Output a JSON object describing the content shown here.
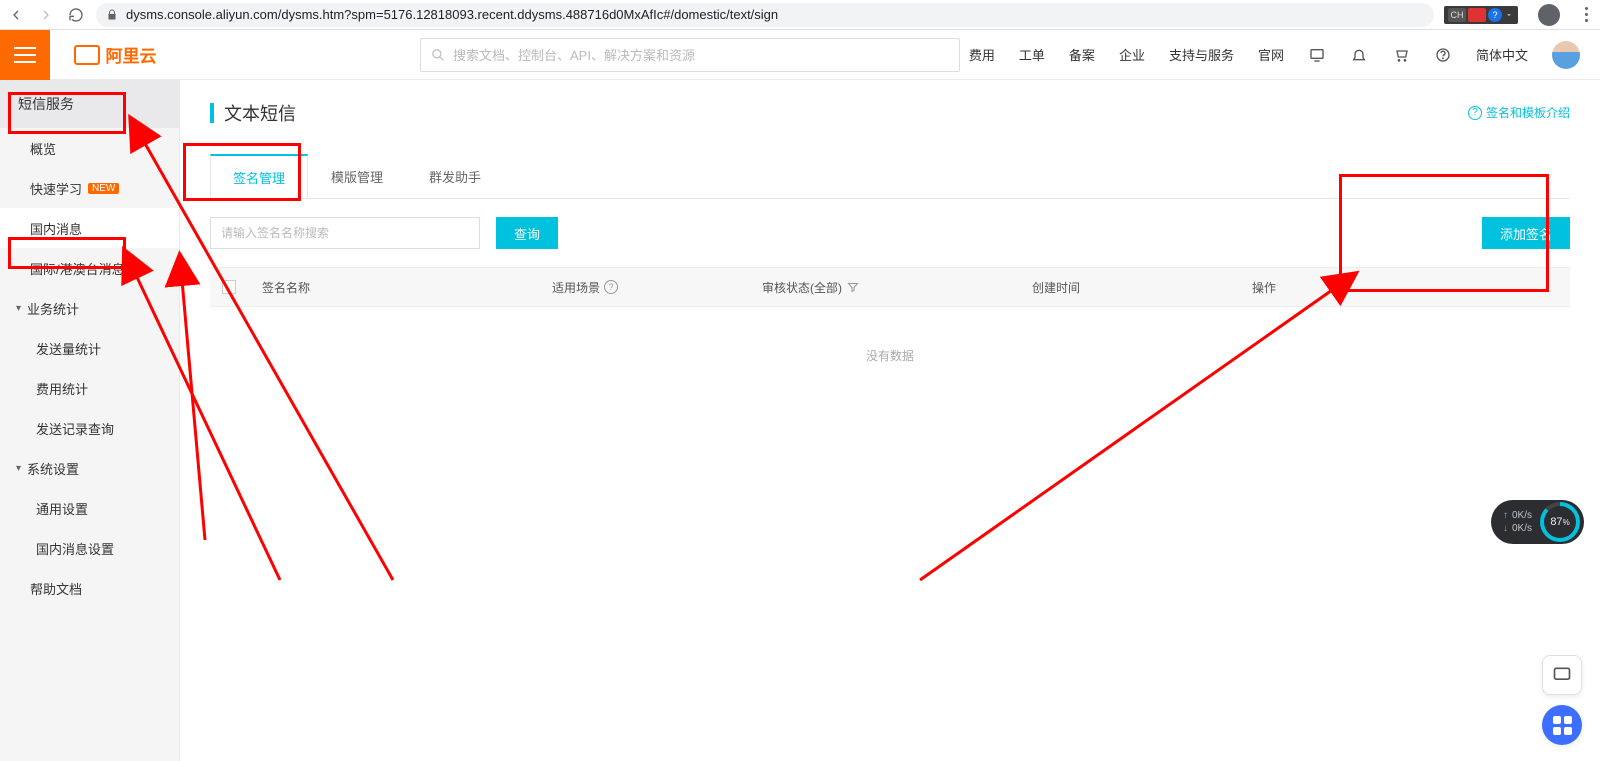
{
  "browser": {
    "url": "dysms.console.aliyun.com/dysms.htm?spm=5176.12818093.recent.ddysms.488716d0MxAfIc#/domestic/text/sign",
    "ext_badge": "CH"
  },
  "logo_text": "阿里云",
  "search_placeholder": "搜索文档、控制台、API、解决方案和资源",
  "top_nav": {
    "fee": "费用",
    "workorder": "工单",
    "beian": "备案",
    "enterprise": "企业",
    "support": "支持与服务",
    "official": "官网",
    "lang": "简体中文"
  },
  "sidebar": {
    "service_title": "短信服务",
    "overview": "概览",
    "quickstart": "快速学习",
    "quickstart_tag": "NEW",
    "domestic": "国内消息",
    "intl": "国际/港澳台消息",
    "stats_group": "业务统计",
    "send_stats": "发送量统计",
    "fee_stats": "费用统计",
    "send_log": "发送记录查询",
    "settings_group": "系统设置",
    "general_settings": "通用设置",
    "domestic_settings": "国内消息设置",
    "help_doc": "帮助文档"
  },
  "page": {
    "title": "文本短信",
    "help_link": "签名和模板介绍"
  },
  "tabs": {
    "sign": "签名管理",
    "template": "模版管理",
    "batch": "群发助手"
  },
  "toolbar": {
    "input_placeholder": "请输入签名名称搜索",
    "query": "查询",
    "add": "添加签名"
  },
  "table": {
    "col_name": "签名名称",
    "col_scene": "适用场景",
    "col_status": "审核状态(全部)",
    "col_time": "创建时间",
    "col_op": "操作",
    "empty": "没有数据"
  },
  "net_widget": {
    "up": "0K/s",
    "down": "0K/s",
    "pct": "87",
    "pct_suffix": "%"
  }
}
